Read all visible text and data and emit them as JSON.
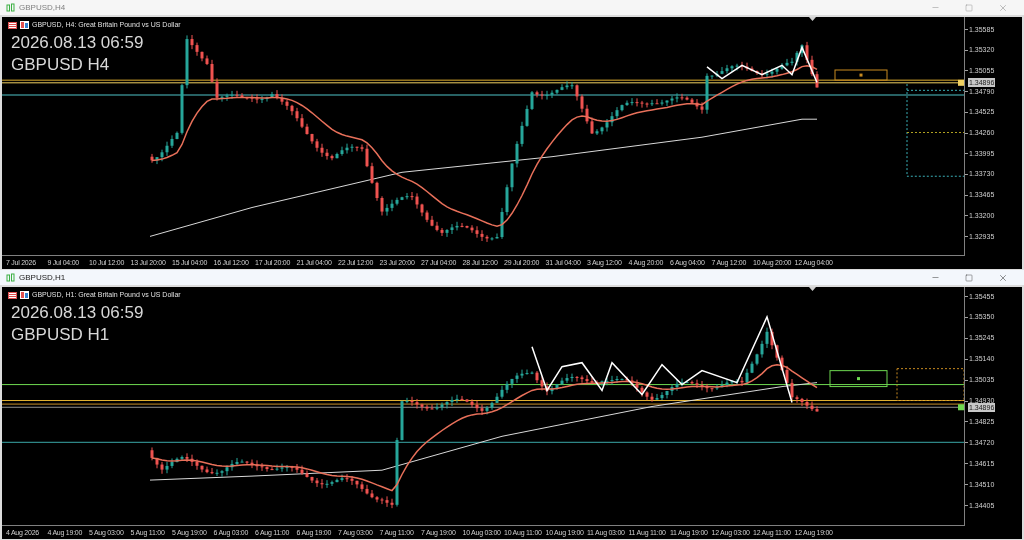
{
  "windows": [
    {
      "title": "GBPUSD,H4",
      "header": "GBPUSD, H4:  Great Britain Pound vs US Dollar",
      "datetime": "2026.08.13 06:59",
      "symbol_label": "GBPUSD H4",
      "active": false,
      "price_ticks": [
        "1.35585",
        "1.35320",
        "1.35055",
        "1.34790",
        "1.34525",
        "1.34260",
        "1.33995",
        "1.33730",
        "1.33465",
        "1.33200",
        "1.32935"
      ],
      "current_price": "1.34896",
      "time_labels": [
        "7 Jul 2026",
        "9 Jul 04:00",
        "10 Jul 12:00",
        "13 Jul 20:00",
        "15 Jul 04:00",
        "16 Jul 12:00",
        "17 Jul 20:00",
        "21 Jul 04:00",
        "22 Jul 12:00",
        "23 Jul 20:00",
        "27 Jul 04:00",
        "28 Jul 12:00",
        "29 Jul 20:00",
        "31 Jul 04:00",
        "3 Aug 12:00",
        "4 Aug 20:00",
        "6 Aug 04:00",
        "7 Aug 12:00",
        "10 Aug 20:00",
        "12 Aug 04:00"
      ]
    },
    {
      "title": "GBPUSD,H1",
      "header": "GBPUSD, H1:  Great Britain Pound vs US Dollar",
      "datetime": "2026.08.13 06:59",
      "symbol_label": "GBPUSD H1",
      "active": true,
      "price_ticks": [
        "1.35455",
        "1.35350",
        "1.35245",
        "1.35140",
        "1.35035",
        "1.34930",
        "1.34825",
        "1.34720",
        "1.34615",
        "1.34510",
        "1.34405"
      ],
      "current_price": "1.34896",
      "time_labels": [
        "4 Aug 2026",
        "4 Aug 19:00",
        "5 Aug 03:00",
        "5 Aug 11:00",
        "5 Aug 19:00",
        "6 Aug 03:00",
        "6 Aug 11:00",
        "6 Aug 19:00",
        "7 Aug 03:00",
        "7 Aug 11:00",
        "7 Aug 19:00",
        "10 Aug 03:00",
        "10 Aug 11:00",
        "10 Aug 19:00",
        "11 Aug 03:00",
        "11 Aug 11:00",
        "11 Aug 19:00",
        "12 Aug 03:00",
        "12 Aug 11:00",
        "12 Aug 19:00"
      ]
    }
  ]
}
